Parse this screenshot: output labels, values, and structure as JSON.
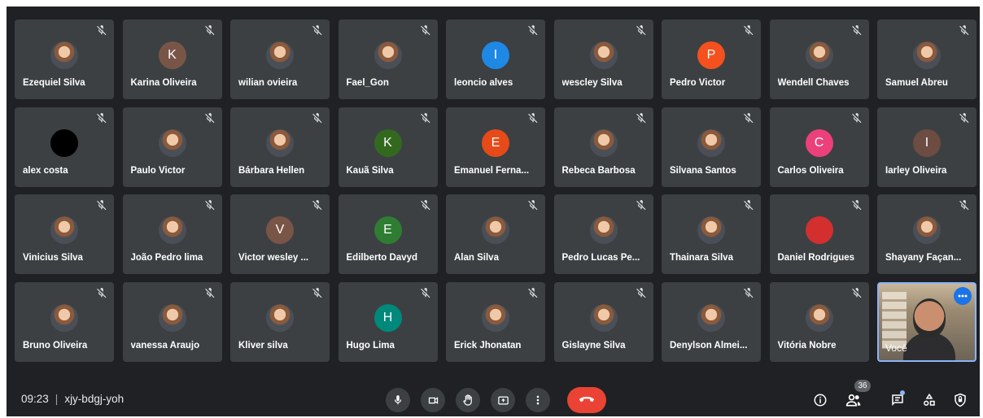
{
  "meeting": {
    "time": "09:23",
    "code": "xjy-bdgj-yoh",
    "participant_count": "36"
  },
  "colors": {
    "background": "#202124",
    "tile": "#3c4043",
    "hangup": "#ea4335",
    "self_border": "#8ab4f8"
  },
  "participants": [
    {
      "name": "Ezequiel Silva",
      "type": "photo",
      "initial": "",
      "color": ""
    },
    {
      "name": "Karina Oliveira",
      "type": "initial",
      "initial": "K",
      "color": "#795548"
    },
    {
      "name": "wilian ovieira",
      "type": "photo",
      "initial": "",
      "color": ""
    },
    {
      "name": "Fael_Gon",
      "type": "photo",
      "initial": "",
      "color": ""
    },
    {
      "name": "leoncio alves",
      "type": "initial",
      "initial": "I",
      "color": "#1e88e5"
    },
    {
      "name": "wescley Silva",
      "type": "photo",
      "initial": "",
      "color": ""
    },
    {
      "name": "Pedro Victor",
      "type": "initial",
      "initial": "P",
      "color": "#f4511e"
    },
    {
      "name": "Wendell Chaves",
      "type": "photo",
      "initial": "",
      "color": ""
    },
    {
      "name": "Samuel Abreu",
      "type": "photo",
      "initial": "",
      "color": ""
    },
    {
      "name": "alex costa",
      "type": "initial",
      "initial": "",
      "color": "#000000"
    },
    {
      "name": "Paulo Victor",
      "type": "photo",
      "initial": "",
      "color": ""
    },
    {
      "name": "Bárbara Hellen",
      "type": "photo",
      "initial": "",
      "color": ""
    },
    {
      "name": "Kauã Silva",
      "type": "initial",
      "initial": "K",
      "color": "#33691e"
    },
    {
      "name": "Emanuel Ferna...",
      "type": "initial",
      "initial": "E",
      "color": "#e64a19"
    },
    {
      "name": "Rebeca Barbosa",
      "type": "photo",
      "initial": "",
      "color": ""
    },
    {
      "name": "Silvana Santos",
      "type": "photo",
      "initial": "",
      "color": ""
    },
    {
      "name": "Carlos Oliveira",
      "type": "initial",
      "initial": "C",
      "color": "#ec407a"
    },
    {
      "name": "Iarley Oliveira",
      "type": "initial",
      "initial": "I",
      "color": "#6d4c41"
    },
    {
      "name": "Vinicius Silva",
      "type": "photo",
      "initial": "",
      "color": ""
    },
    {
      "name": "João Pedro lima",
      "type": "photo",
      "initial": "",
      "color": ""
    },
    {
      "name": "Victor wesley ...",
      "type": "initial",
      "initial": "V",
      "color": "#795548"
    },
    {
      "name": "Edilberto Davyd",
      "type": "initial",
      "initial": "E",
      "color": "#2e7d32"
    },
    {
      "name": "Alan Silva",
      "type": "photo",
      "initial": "",
      "color": ""
    },
    {
      "name": "Pedro Lucas Pe...",
      "type": "photo",
      "initial": "",
      "color": ""
    },
    {
      "name": "Thainara Silva",
      "type": "photo",
      "initial": "",
      "color": ""
    },
    {
      "name": "Daniel Rodrigues",
      "type": "initial",
      "initial": "",
      "color": "#d32f2f"
    },
    {
      "name": "Shayany Façan...",
      "type": "photo",
      "initial": "",
      "color": ""
    },
    {
      "name": "Bruno Oliveira",
      "type": "photo",
      "initial": "",
      "color": ""
    },
    {
      "name": "vanessa Araujo",
      "type": "photo",
      "initial": "",
      "color": ""
    },
    {
      "name": "Kliver silva",
      "type": "photo",
      "initial": "",
      "color": ""
    },
    {
      "name": "Hugo Lima",
      "type": "initial",
      "initial": "H",
      "color": "#00897b"
    },
    {
      "name": "Erick Jhonatan",
      "type": "photo",
      "initial": "",
      "color": ""
    },
    {
      "name": "Gislayne Silva",
      "type": "photo",
      "initial": "",
      "color": ""
    },
    {
      "name": "Denylson Almei...",
      "type": "photo",
      "initial": "",
      "color": ""
    },
    {
      "name": "Vitória Nobre",
      "type": "photo",
      "initial": "",
      "color": ""
    }
  ],
  "self": {
    "name": "Você"
  },
  "icons": {
    "muted": "mic-off-icon",
    "mic": "mic-icon",
    "camera": "camera-icon",
    "hand": "raise-hand-icon",
    "present": "present-screen-icon",
    "more": "more-options-icon",
    "hangup": "hangup-icon",
    "info": "info-icon",
    "people": "people-icon",
    "chat": "chat-icon",
    "activities": "activities-icon",
    "host": "host-controls-icon"
  }
}
